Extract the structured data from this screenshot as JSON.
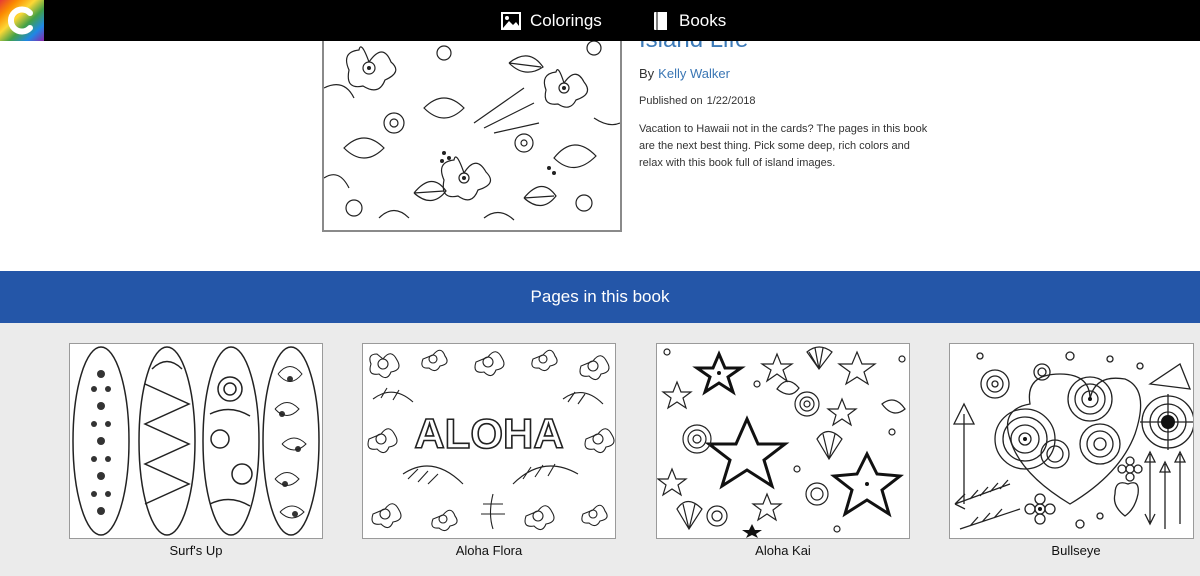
{
  "nav": {
    "colorings_label": "Colorings",
    "books_label": "Books"
  },
  "book": {
    "title": "Island Life",
    "by_label": "By",
    "author": "Kelly Walker",
    "published_label": "Published on",
    "published_date": "1/22/2018",
    "description": "Vacation to Hawaii not in the cards? The pages in this book are the next best thing. Pick some deep, rich colors and relax with this book full of island images."
  },
  "pages_section": {
    "heading": "Pages in this book",
    "pages": [
      {
        "title": "Surf's Up"
      },
      {
        "title": "Aloha Flora",
        "art_text": "ALOHA"
      },
      {
        "title": "Aloha Kai"
      },
      {
        "title": "Bullseye"
      }
    ]
  },
  "colors": {
    "topbar": "#000000",
    "band": "#2456a8",
    "link": "#3a76b4",
    "pages_bg": "#ebebeb"
  }
}
